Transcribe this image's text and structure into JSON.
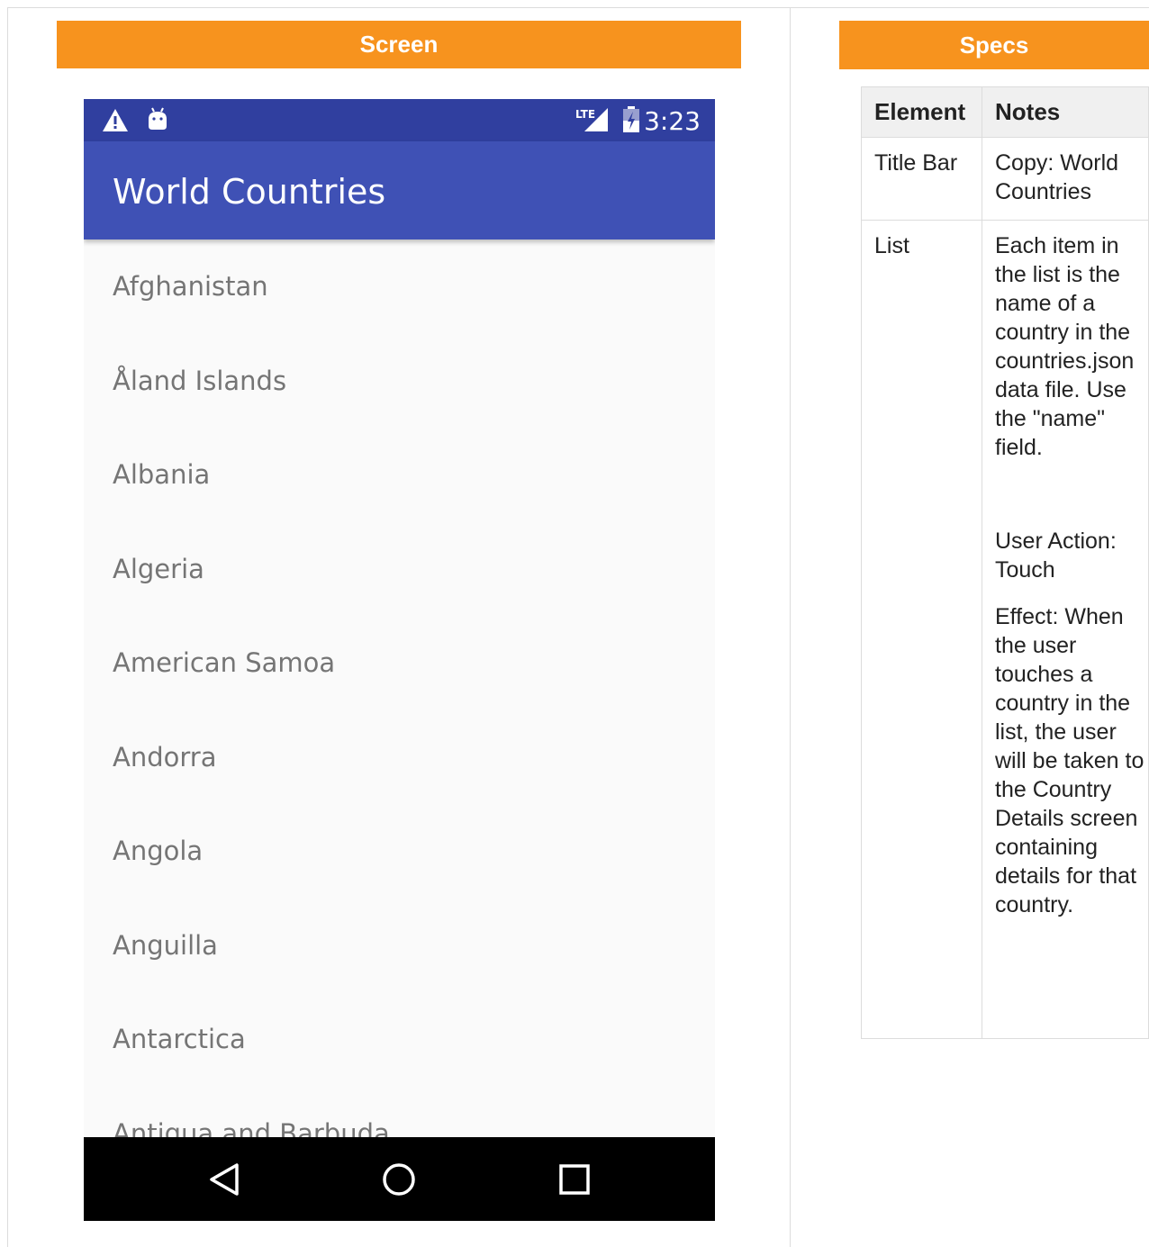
{
  "headers": {
    "screen": "Screen",
    "specs": "Specs"
  },
  "phone": {
    "status_bar": {
      "time": "3:23",
      "icons": [
        "warning-icon",
        "android-icon",
        "lte-signal-icon",
        "battery-icon"
      ],
      "network_label": "LTE"
    },
    "app_bar": {
      "title": "World Countries"
    },
    "list": [
      "Afghanistan",
      "Åland Islands",
      "Albania",
      "Algeria",
      "American Samoa",
      "Andorra",
      "Angola",
      "Anguilla",
      "Antarctica",
      "Antigua and Barbuda"
    ],
    "nav_bar": {
      "icons": [
        "back-icon",
        "home-icon",
        "recents-icon"
      ]
    },
    "colors": {
      "status_bar": "#303f9f",
      "app_bar": "#3f51b5",
      "nav_bar": "#000000",
      "list_text": "#757575"
    }
  },
  "specs_table": {
    "columns": [
      "Element",
      "Notes"
    ],
    "rows": [
      {
        "element": "Title Bar",
        "notes": [
          "Copy: World Countries"
        ]
      },
      {
        "element": "List",
        "notes": [
          "Each item in the list is the name of a country in the countries.json data file. Use the \"name\" field.",
          "User Action: Touch",
          "Effect: When the user touches a country in the list, the user will be taken to the Country Details screen containing details for that country."
        ]
      }
    ]
  },
  "accent_color": "#f7931e"
}
